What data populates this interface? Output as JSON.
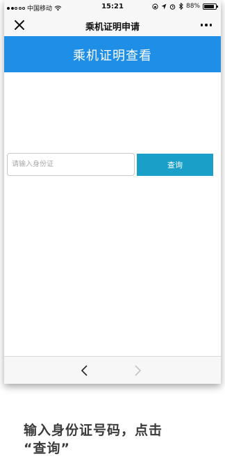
{
  "status_bar": {
    "carrier": "中国移动",
    "time": "15:21",
    "battery": "88%",
    "battery_level": 0.88
  },
  "nav": {
    "title": "乘机证明申请",
    "close_icon": "close-icon",
    "more_icon": "more-icon"
  },
  "banner": {
    "title": "乘机证明查看",
    "color": "#1e8ee6"
  },
  "form": {
    "id_placeholder": "请输入身份证",
    "id_value": "",
    "query_label": "查询",
    "button_color": "#1aa0c8"
  },
  "toolbar": {
    "back_icon": "chevron-left-icon",
    "forward_icon": "chevron-right-icon"
  },
  "caption": {
    "line1": "输入身份证号码，点击",
    "line2": "“查询”"
  }
}
